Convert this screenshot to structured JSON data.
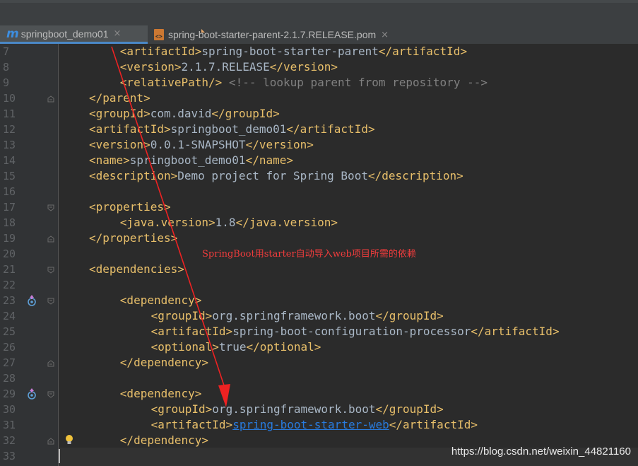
{
  "tabs": [
    {
      "label": "springboot_demo01",
      "icon": "maven-m-icon",
      "active": true
    },
    {
      "label": "spring-boot-starter-parent-2.1.7.RELEASE.pom",
      "icon": "pom-file-icon",
      "active": false
    }
  ],
  "close_glyph": "×",
  "annotation": "SpringBoot用starter自动导入web项目所需的依赖",
  "watermark": "https://blog.csdn.net/weixin_44821160",
  "colors": {
    "tag": "#e8bf6a",
    "text": "#a9b7c6",
    "comment": "#808080",
    "link": "#287bde",
    "annotation": "#f03c3c"
  },
  "lines": [
    {
      "n": "7",
      "indent": 2,
      "parts": [
        {
          "t": "tag",
          "v": "<artifactId>"
        },
        {
          "t": "txt",
          "v": "spring-boot-starter-parent"
        },
        {
          "t": "tag",
          "v": "</artifactId>"
        }
      ]
    },
    {
      "n": "8",
      "indent": 2,
      "parts": [
        {
          "t": "tag",
          "v": "<version>"
        },
        {
          "t": "txt",
          "v": "2.1.7.RELEASE"
        },
        {
          "t": "tag",
          "v": "</version>"
        }
      ]
    },
    {
      "n": "9",
      "indent": 2,
      "parts": [
        {
          "t": "tag",
          "v": "<relativePath/>"
        },
        {
          "t": "cmt",
          "v": " <!-- lookup parent from repository -->"
        }
      ]
    },
    {
      "n": "10",
      "indent": 1,
      "fold": "end",
      "parts": [
        {
          "t": "tag",
          "v": "</parent>"
        }
      ]
    },
    {
      "n": "11",
      "indent": 1,
      "parts": [
        {
          "t": "tag",
          "v": "<groupId>"
        },
        {
          "t": "txt",
          "v": "com.david"
        },
        {
          "t": "tag",
          "v": "</groupId>"
        }
      ]
    },
    {
      "n": "12",
      "indent": 1,
      "parts": [
        {
          "t": "tag",
          "v": "<artifactId>"
        },
        {
          "t": "txt",
          "v": "springboot_demo01"
        },
        {
          "t": "tag",
          "v": "</artifactId>"
        }
      ]
    },
    {
      "n": "13",
      "indent": 1,
      "parts": [
        {
          "t": "tag",
          "v": "<version>"
        },
        {
          "t": "txt",
          "v": "0.0.1-SNAPSHOT"
        },
        {
          "t": "tag",
          "v": "</version>"
        }
      ]
    },
    {
      "n": "14",
      "indent": 1,
      "parts": [
        {
          "t": "tag",
          "v": "<name>"
        },
        {
          "t": "txt",
          "v": "springboot_demo01"
        },
        {
          "t": "tag",
          "v": "</name>"
        }
      ]
    },
    {
      "n": "15",
      "indent": 1,
      "parts": [
        {
          "t": "tag",
          "v": "<description>"
        },
        {
          "t": "txt",
          "v": "Demo project for Spring Boot"
        },
        {
          "t": "tag",
          "v": "</description>"
        }
      ]
    },
    {
      "n": "16",
      "indent": 0,
      "parts": []
    },
    {
      "n": "17",
      "indent": 1,
      "fold": "start",
      "parts": [
        {
          "t": "tag",
          "v": "<properties>"
        }
      ]
    },
    {
      "n": "18",
      "indent": 2,
      "parts": [
        {
          "t": "tag",
          "v": "<java.version>"
        },
        {
          "t": "txt",
          "v": "1.8"
        },
        {
          "t": "tag",
          "v": "</java.version>"
        }
      ]
    },
    {
      "n": "19",
      "indent": 1,
      "fold": "end",
      "parts": [
        {
          "t": "tag",
          "v": "</properties>"
        }
      ]
    },
    {
      "n": "20",
      "indent": 0,
      "parts": []
    },
    {
      "n": "21",
      "indent": 1,
      "fold": "start",
      "parts": [
        {
          "t": "tag",
          "v": "<dependencies>"
        }
      ]
    },
    {
      "n": "22",
      "indent": 0,
      "parts": []
    },
    {
      "n": "23",
      "indent": 2,
      "fold": "start",
      "gutter_icon": "dependency-update-icon",
      "parts": [
        {
          "t": "tag",
          "v": "<dependency>"
        }
      ]
    },
    {
      "n": "24",
      "indent": 3,
      "parts": [
        {
          "t": "tag",
          "v": "<groupId>"
        },
        {
          "t": "txt",
          "v": "org.springframework.boot"
        },
        {
          "t": "tag",
          "v": "</groupId>"
        }
      ]
    },
    {
      "n": "25",
      "indent": 3,
      "parts": [
        {
          "t": "tag",
          "v": "<artifactId>"
        },
        {
          "t": "txt",
          "v": "spring-boot-configuration-processor"
        },
        {
          "t": "tag",
          "v": "</artifactId>"
        }
      ]
    },
    {
      "n": "26",
      "indent": 3,
      "parts": [
        {
          "t": "tag",
          "v": "<optional>"
        },
        {
          "t": "txt",
          "v": "true"
        },
        {
          "t": "tag",
          "v": "</optional>"
        }
      ]
    },
    {
      "n": "27",
      "indent": 2,
      "fold": "end",
      "parts": [
        {
          "t": "tag",
          "v": "</dependency>"
        }
      ]
    },
    {
      "n": "28",
      "indent": 0,
      "parts": []
    },
    {
      "n": "29",
      "indent": 2,
      "fold": "start",
      "gutter_icon": "dependency-update-icon",
      "parts": [
        {
          "t": "tag",
          "v": "<dependency>"
        }
      ]
    },
    {
      "n": "30",
      "indent": 3,
      "parts": [
        {
          "t": "tag",
          "v": "<groupId>"
        },
        {
          "t": "txt",
          "v": "org.springframework.boot"
        },
        {
          "t": "tag",
          "v": "</groupId>"
        }
      ]
    },
    {
      "n": "31",
      "indent": 3,
      "parts": [
        {
          "t": "tag",
          "v": "<artifactId>"
        },
        {
          "t": "lnk",
          "v": "spring-boot-starter-web"
        },
        {
          "t": "tag",
          "v": "</artifactId>"
        }
      ]
    },
    {
      "n": "32",
      "indent": 2,
      "fold": "end",
      "bulb": true,
      "parts": [
        {
          "t": "tag",
          "v": "</dependency>"
        }
      ]
    },
    {
      "n": "33",
      "indent": 0,
      "parts": []
    }
  ]
}
